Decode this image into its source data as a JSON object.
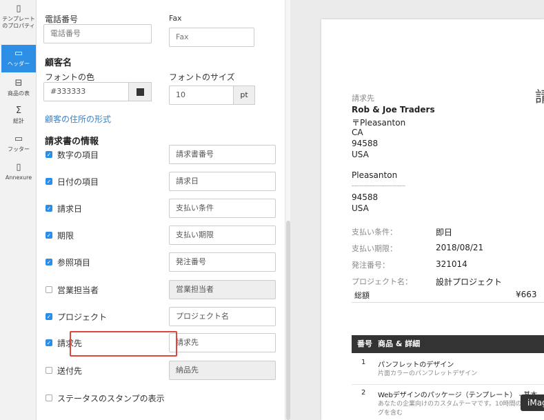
{
  "nav": [
    {
      "label": "テンプレートのプロパティ",
      "icon": "document-icon"
    },
    {
      "label": "ヘッダー",
      "icon": "header-icon",
      "active": true
    },
    {
      "label": "商品の表",
      "icon": "table-icon"
    },
    {
      "label": "総計",
      "icon": "sigma-icon"
    },
    {
      "label": "フッター",
      "icon": "footer-icon"
    },
    {
      "label": "Annexure",
      "icon": "attachment-icon"
    }
  ],
  "form": {
    "phone_label": "電話番号",
    "phone_placeholder": "電話番号",
    "fax_label": "Fax",
    "fax_placeholder": "Fax",
    "customer_heading": "顧客名",
    "font_color_label": "フォントの色",
    "font_color_value": "#333333",
    "font_size_label": "フォントのサイズ",
    "font_size_value": "10",
    "font_size_unit": "pt",
    "address_format_link": "顧客の住所の形式",
    "invoice_info_heading": "請求書の情報",
    "fields": [
      {
        "label": "数字の項目",
        "checked": true,
        "value": "請求書番号"
      },
      {
        "label": "日付の項目",
        "checked": true,
        "value": "請求日"
      },
      {
        "label": "請求日",
        "checked": true,
        "value": "支払い条件"
      },
      {
        "label": "期限",
        "checked": true,
        "value": "支払い期限"
      },
      {
        "label": "参照項目",
        "checked": true,
        "value": "発注番号"
      },
      {
        "label": "営業担当者",
        "checked": false,
        "value": "営業担当者"
      },
      {
        "label": "プロジェクト",
        "checked": true,
        "value": "プロジェクト名"
      },
      {
        "label": "請求先",
        "checked": true,
        "value": "請求先"
      },
      {
        "label": "送付先",
        "checked": false,
        "value": "納品先"
      },
      {
        "label": "ステータスのスタンプの表示",
        "checked": false
      }
    ]
  },
  "preview": {
    "title_partial": "請",
    "bill_to_label": "請求先",
    "customer": "Rob & Joe Traders",
    "address1": [
      "〒Pleasanton",
      "CA",
      "94588",
      "USA"
    ],
    "address2": [
      "Pleasanton",
      "------------------------------------",
      "94588",
      "USA"
    ],
    "details": [
      {
        "k": "支払い条件：",
        "v": "即日"
      },
      {
        "k": "支払い期限：",
        "v": "2018/08/21"
      },
      {
        "k": "発注番号：",
        "v": "321014"
      },
      {
        "k": "プロジェクト名：",
        "v": "設計プロジェクト"
      }
    ],
    "total_label": "総額",
    "total_value": "¥663",
    "table_headers": [
      "番号",
      "商品 & 詳細"
    ],
    "items": [
      {
        "no": "1",
        "name": "パンフレットのデザイン",
        "desc": "片面カラーのパンフレットデザイン"
      },
      {
        "no": "2",
        "name": "Webデザインのパッケージ（テンプレート） - 基本",
        "desc": "あなたの企業向けのカスタムテーマです。10時間の",
        "desc2": "グを含む"
      }
    ]
  },
  "tooltip": "iMag"
}
